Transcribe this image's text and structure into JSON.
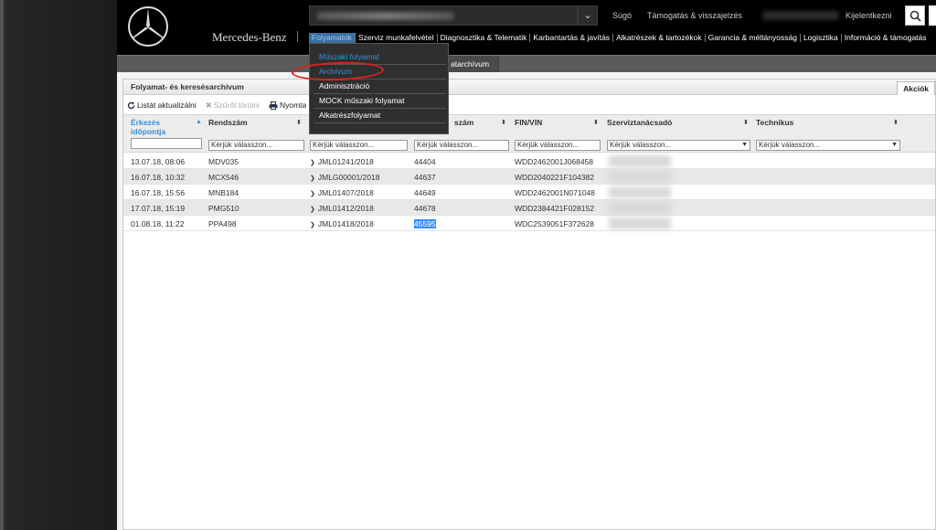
{
  "header": {
    "brand": "Mercedes-Benz",
    "links": {
      "help": "Súgó",
      "support": "Támogatás & visszajelzés",
      "logout": "Kijelentkezni"
    },
    "nav": [
      "Folyamatok",
      "Szerviz munkafelvétel",
      "Diagnosztika & Telematik",
      "Karbantartás & javítás",
      "Alkatrészek & tartozékok",
      "Garancia & méltányosság",
      "Logisztika",
      "Információ & támogatás"
    ]
  },
  "subnav": {
    "item": "atarchívum"
  },
  "dropdown": {
    "items": [
      "Műszaki folyamat",
      "Archívum",
      "Adminisztráció",
      "MOCK műszaki folyamat",
      "Alkatrészfolyamat"
    ]
  },
  "panel": {
    "title": "Folyamat- és keresésarchívum",
    "tab": "Akciók",
    "toolbar": {
      "refresh": "Listát aktualizálni",
      "clear_filter": "Szűrőt törölni",
      "print": "Nyomta"
    }
  },
  "table": {
    "headers": {
      "arrival": "Érkezés időpontja",
      "plate": "Rendszám",
      "order": "szám",
      "fin": "FIN/VIN",
      "advisor": "Szerviztanácsadó",
      "tech": "Technikus"
    },
    "filter_placeholder": "Kérjük válasszon...",
    "rows": [
      [
        "13.07.18, 08:06",
        "MDV035",
        "JML01241/2018",
        "44404",
        "WDD2462001J068458"
      ],
      [
        "16.07.18, 10:32",
        "MCX546",
        "JMLG00001/2018",
        "44637",
        "WDD2040221F104382"
      ],
      [
        "16.07.18, 15:56",
        "MNB184",
        "JML01407/2018",
        "44649",
        "WDD2462001N071048"
      ],
      [
        "17.07.18, 15:19",
        "PMG510",
        "JML01412/2018",
        "44678",
        "WDD2384421F028152"
      ],
      [
        "01.08.18, 11:22",
        "PPA498",
        "JML01418/2018",
        "45595",
        "WDC2539051F372628"
      ]
    ]
  },
  "colors": {
    "accent": "#3a8fd6",
    "annotation": "#e0201b"
  }
}
